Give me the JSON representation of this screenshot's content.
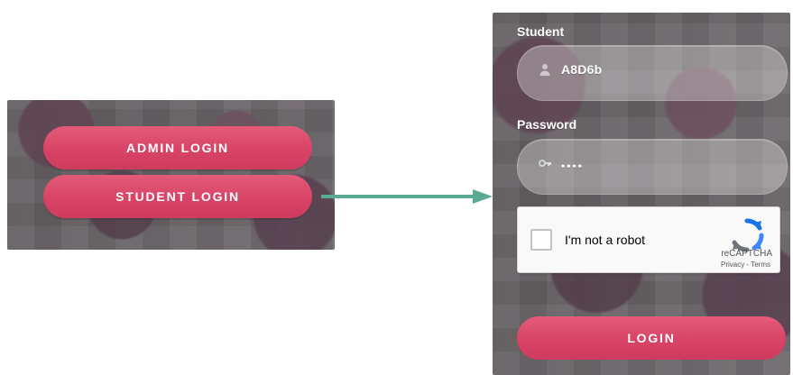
{
  "left": {
    "admin_label": "ADMIN LOGIN",
    "student_label": "STUDENT LOGIN"
  },
  "right": {
    "student_label": "Student",
    "student_value": "A8D6b",
    "password_label": "Password",
    "password_mask": "••••",
    "recaptcha": {
      "checkbox_text": "I'm not a robot",
      "brand": "reCAPTCHA",
      "links": "Privacy - Terms"
    },
    "login_label": "LOGIN"
  },
  "colors": {
    "accent_pink": "#d84366",
    "arrow_teal": "#5aa992"
  },
  "icons": {
    "user": "user-icon",
    "key": "key-icon",
    "recaptcha": "recaptcha-icon",
    "arrow": "right-arrow-icon"
  }
}
